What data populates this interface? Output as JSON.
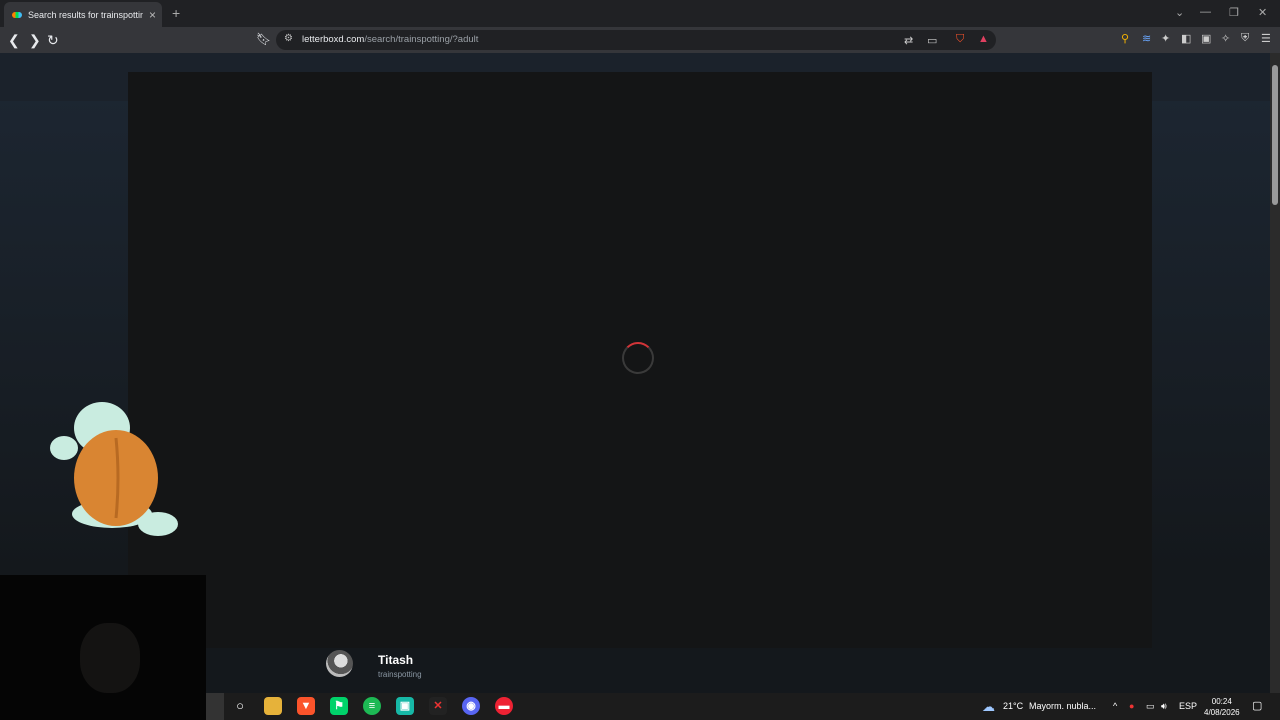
{
  "browser": {
    "tab_title": "Search results for trainspotting •",
    "tab_close": "×",
    "new_tab": "+",
    "url_host": "letterboxd.com",
    "url_path": "/search/trainspotting/?adult",
    "icons": [
      "back-icon",
      "forward-icon",
      "reload-icon",
      "bookmark-icon",
      "tune-icon",
      "translate-icon",
      "cast-icon",
      "brave-shields-icon",
      "brave-rewards-icon",
      "extension-key-icon",
      "extension-wave-icon",
      "extensions-icon",
      "sidebar-icon",
      "wallet-icon",
      "leo-icon",
      "vpn-icon",
      "menu-icon"
    ]
  },
  "page": {
    "loading": true,
    "spinner_color": "#d13438",
    "result": {
      "name": "Titash",
      "subtitle": "trainspotting"
    }
  },
  "taskbar": {
    "weather_temp": "21°C",
    "weather_text": "Mayorm. nubla...",
    "language": "ESP",
    "time": "00:24",
    "date": "4/08/2026",
    "apps": [
      "file-explorer-icon",
      "brave-icon",
      "app-green-icon",
      "spotify-icon",
      "app-teal-icon",
      "app-red-x-icon",
      "discord-icon",
      "app-red-icon"
    ]
  },
  "colors": {
    "brand_orange": "#ff8000",
    "brand_green": "#00e054",
    "brand_blue": "#40bcf4"
  }
}
